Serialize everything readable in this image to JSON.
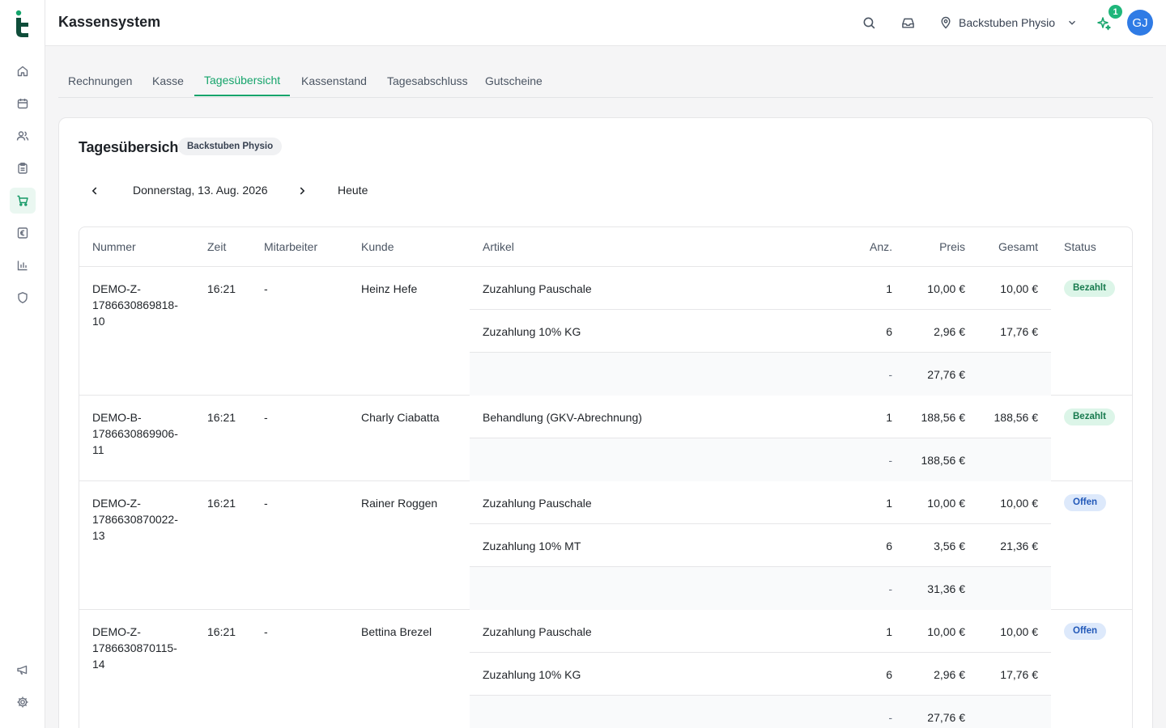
{
  "header": {
    "title": "Kassensystem",
    "location": "Backstuben Physio",
    "notification_count": "1",
    "avatar_initials": "GJ"
  },
  "sidebar": {
    "items": [
      {
        "icon": "home-icon",
        "active": false
      },
      {
        "icon": "calendar-icon",
        "active": false
      },
      {
        "icon": "users-icon",
        "active": false
      },
      {
        "icon": "clipboard-icon",
        "active": false
      },
      {
        "icon": "cart-icon",
        "active": true
      },
      {
        "icon": "euro-icon",
        "active": false
      },
      {
        "icon": "chart-icon",
        "active": false
      },
      {
        "icon": "shield-icon",
        "active": false
      }
    ],
    "bottom_items": [
      {
        "icon": "megaphone-icon"
      },
      {
        "icon": "gear-icon"
      }
    ]
  },
  "tabs": [
    {
      "label": "Rechnungen"
    },
    {
      "label": "Kasse"
    },
    {
      "label": "Tagesübersicht",
      "active": true
    },
    {
      "label": "Kassenstand"
    },
    {
      "label": "Tagesabschluss"
    },
    {
      "label": "Gutscheine"
    }
  ],
  "card": {
    "title": "Tagesübersicht",
    "location_badge": "Backstuben Physio",
    "date": "Donnerstag, 13. Aug. 2026",
    "today_label": "Heute"
  },
  "table": {
    "columns": {
      "nummer": "Nummer",
      "zeit": "Zeit",
      "mitarbeiter": "Mitarbeiter",
      "kunde": "Kunde",
      "artikel": "Artikel",
      "anz": "Anz.",
      "preis": "Preis",
      "gesamt": "Gesamt",
      "status": "Status"
    },
    "rows": [
      {
        "nummer": "DEMO-Z-\n1786630869818-\n10",
        "zeit": "16:21",
        "mitarbeiter": "-",
        "kunde": "Heinz Hefe",
        "status": "Bezahlt",
        "items": [
          {
            "artikel": "Zuzahlung Pauschale",
            "anz": "1",
            "preis": "10,00 €",
            "gesamt": "10,00 €"
          },
          {
            "artikel": "Zuzahlung 10% KG",
            "anz": "6",
            "preis": "2,96 €",
            "gesamt": "17,76 €"
          }
        ],
        "sum_dash": "-",
        "sum": "27,76 €"
      },
      {
        "nummer": "DEMO-B-\n1786630869906-\n11",
        "zeit": "16:21",
        "mitarbeiter": "-",
        "kunde": "Charly Ciabatta",
        "status": "Bezahlt",
        "items": [
          {
            "artikel": "Behandlung (GKV-Abrechnung)",
            "anz": "1",
            "preis": "188,56 €",
            "gesamt": "188,56 €"
          }
        ],
        "sum_dash": "-",
        "sum": "188,56 €"
      },
      {
        "nummer": "DEMO-Z-\n1786630870022-\n13",
        "zeit": "16:21",
        "mitarbeiter": "-",
        "kunde": "Rainer Roggen",
        "status": "Offen",
        "items": [
          {
            "artikel": "Zuzahlung Pauschale",
            "anz": "1",
            "preis": "10,00 €",
            "gesamt": "10,00 €"
          },
          {
            "artikel": "Zuzahlung 10% MT",
            "anz": "6",
            "preis": "3,56 €",
            "gesamt": "21,36 €"
          }
        ],
        "sum_dash": "-",
        "sum": "31,36 €"
      },
      {
        "nummer": "DEMO-Z-\n1786630870115-\n14",
        "zeit": "16:21",
        "mitarbeiter": "-",
        "kunde": "Bettina Brezel",
        "status": "Offen",
        "items": [
          {
            "artikel": "Zuzahlung Pauschale",
            "anz": "1",
            "preis": "10,00 €",
            "gesamt": "10,00 €"
          },
          {
            "artikel": "Zuzahlung 10% KG",
            "anz": "6",
            "preis": "2,96 €",
            "gesamt": "17,76 €"
          }
        ],
        "sum_dash": "-",
        "sum": "27,76 €"
      }
    ]
  }
}
